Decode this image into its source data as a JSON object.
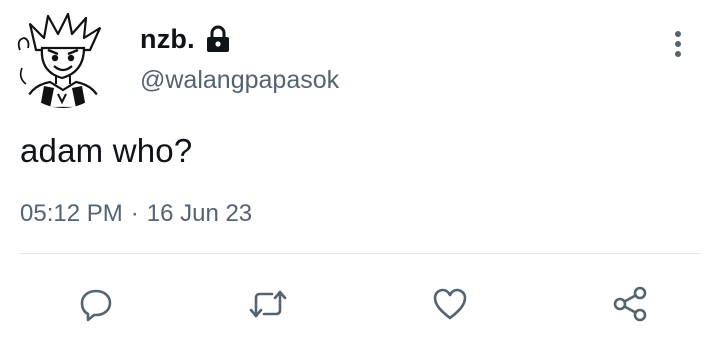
{
  "author": {
    "display_name": "nzb.",
    "handle": "@walangpapasok",
    "avatar_icon": "anime-character-avatar",
    "protected_icon": "lock-icon"
  },
  "tweet": {
    "text": "adam who?",
    "time": "05:12 PM",
    "separator": "·",
    "date": "16 Jun 23"
  },
  "actions": [
    {
      "name": "reply",
      "icon": "reply-icon"
    },
    {
      "name": "retweet",
      "icon": "retweet-icon"
    },
    {
      "name": "like",
      "icon": "heart-icon"
    },
    {
      "name": "share",
      "icon": "share-icon"
    }
  ],
  "colors": {
    "text_primary": "#0f1419",
    "text_secondary": "#536471",
    "icon": "#536471",
    "divider": "#e1e6ea"
  }
}
